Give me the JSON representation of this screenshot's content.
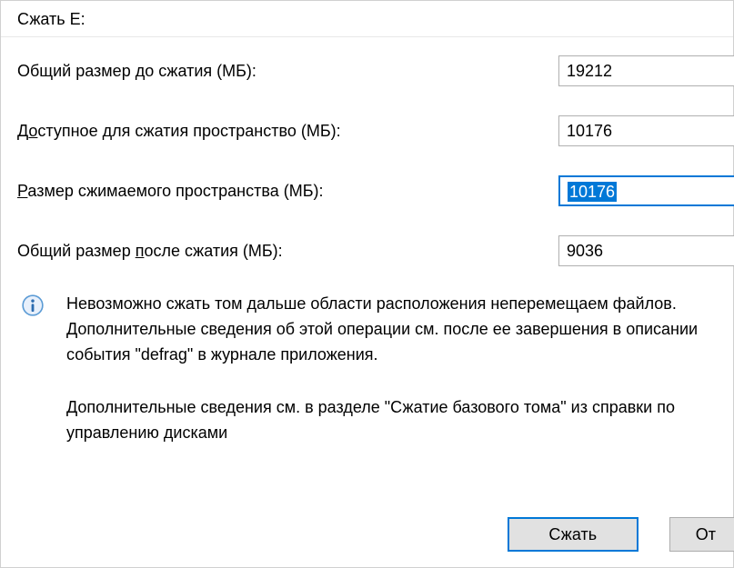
{
  "title": "Сжать E:",
  "rows": {
    "total_before": {
      "label_pre": "Общий размер ",
      "label_u": "д",
      "label_post": "о сжатия (МБ):",
      "value": "19212"
    },
    "available": {
      "label_pre": "Д",
      "label_u": "о",
      "label_post": "ступное для сжатия пространство (МБ):",
      "value": "10176"
    },
    "shrink_amount": {
      "label_pre": "",
      "label_u": "Р",
      "label_post": "азмер сжимаемого пространства (МБ):",
      "value": "10176"
    },
    "total_after": {
      "label_pre": "Общий размер ",
      "label_u": "п",
      "label_post": "осле сжатия (МБ):",
      "value": "9036"
    }
  },
  "info": {
    "para1": "Невозможно сжать том дальше области расположения неперемещаем файлов. Дополнительные сведения об этой операции см. после ее завершения в описании события \"defrag\" в журнале приложения.",
    "para2": "Дополнительные сведения см. в разделе \"Сжатие базового тома\" из справки по управлению дисками"
  },
  "buttons": {
    "shrink": "Сжать",
    "cancel": "От"
  }
}
